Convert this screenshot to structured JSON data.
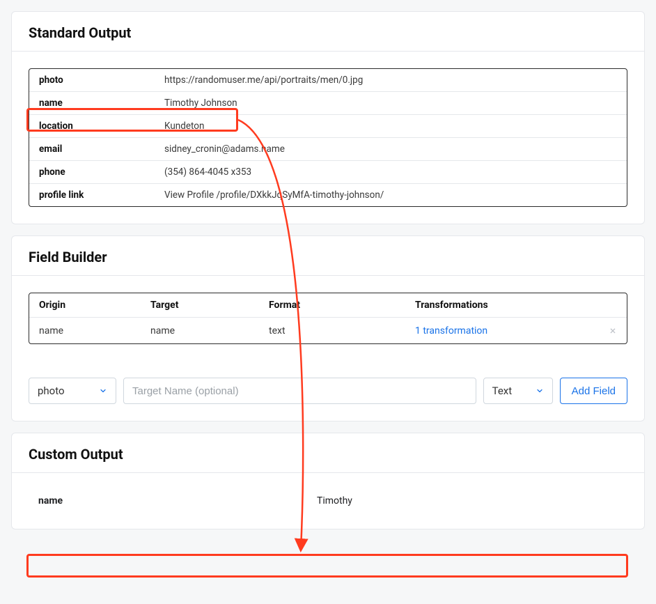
{
  "standardOutput": {
    "title": "Standard Output",
    "rows": [
      {
        "key": "photo",
        "value": "https://randomuser.me/api/portraits/men/0.jpg"
      },
      {
        "key": "name",
        "value": "Timothy Johnson"
      },
      {
        "key": "location",
        "value": "Kundeton"
      },
      {
        "key": "email",
        "value": "sidney_cronin@adams.name"
      },
      {
        "key": "phone",
        "value": "(354) 864-4045 x353"
      },
      {
        "key": "profile link",
        "value": "View Profile /profile/DXkkJqSyMfA-timothy-johnson/"
      }
    ]
  },
  "fieldBuilder": {
    "title": "Field Builder",
    "headers": {
      "origin": "Origin",
      "target": "Target",
      "format": "Format",
      "transformations": "Transformations"
    },
    "row": {
      "origin": "name",
      "target": "name",
      "format": "text",
      "transformations": "1 transformation"
    },
    "inputs": {
      "originSelect": "photo",
      "targetPlaceholder": "Target Name (optional)",
      "formatSelect": "Text",
      "addButton": "Add Field"
    }
  },
  "customOutput": {
    "title": "Custom Output",
    "row": {
      "key": "name",
      "value": "Timothy"
    }
  },
  "colors": {
    "highlight": "#ff3b1f",
    "link": "#1a73e8"
  }
}
